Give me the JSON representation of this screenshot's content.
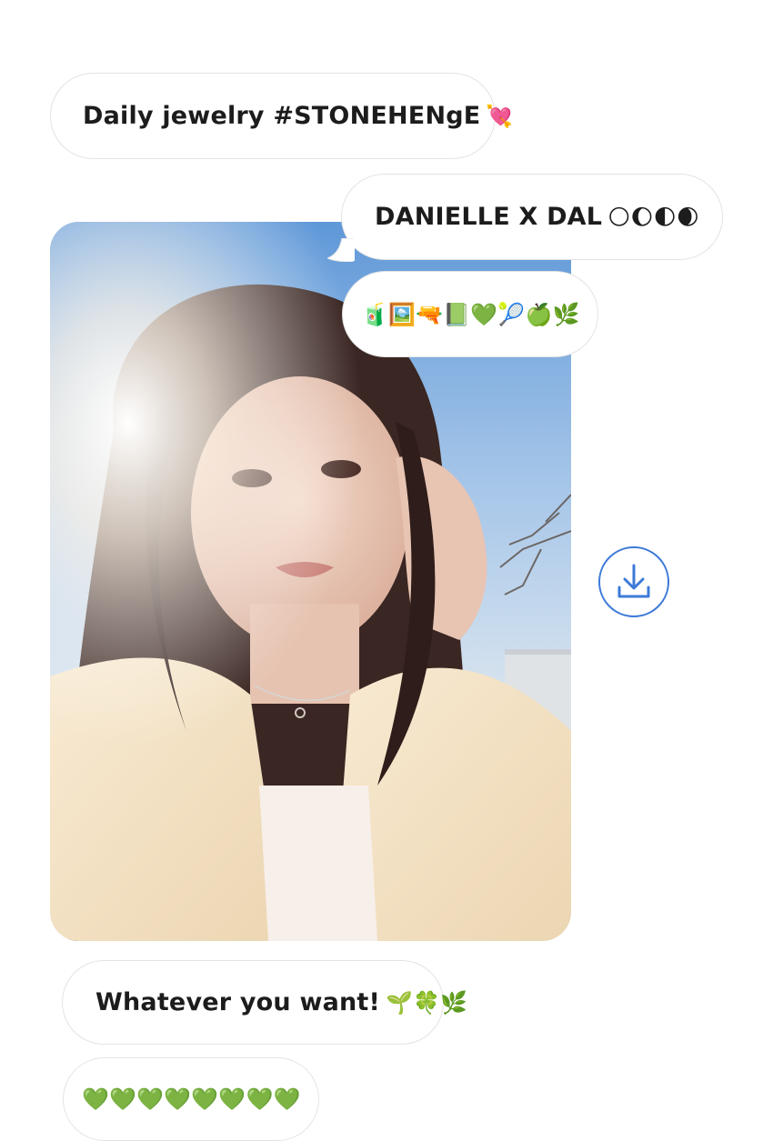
{
  "messages": [
    {
      "text": "Daily jewelry #STONEHENgE",
      "emoji": "💘"
    },
    {
      "text": "DANIELLE X DAL",
      "emoji": "🌕🌔🌓🌒"
    },
    {
      "text": "",
      "emoji": "🧃🖼️🔫📗💚🎾🍏🌿"
    },
    {
      "text": "Whatever you want!",
      "emoji": "🌱🍀🌿"
    },
    {
      "text": "",
      "emoji": "💚💚💚💚💚💚💚💚"
    }
  ],
  "download": {
    "icon": "download-icon",
    "accent": "#3d7ad8"
  },
  "photo": {
    "description_icon": "selfie-photo"
  }
}
